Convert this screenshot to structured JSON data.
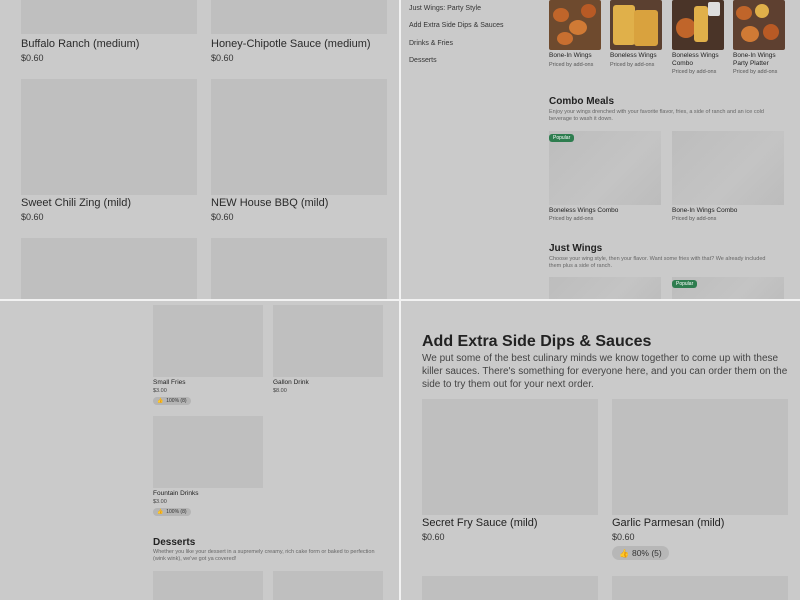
{
  "q1": {
    "items": [
      {
        "name": "Buffalo Ranch (medium)",
        "price": "$0.60"
      },
      {
        "name": "Honey-Chipotle Sauce (medium)",
        "price": "$0.60"
      },
      {
        "name": "Sweet Chili Zing (mild)",
        "price": "$0.60"
      },
      {
        "name": "NEW House BBQ (mild)",
        "price": "$0.60"
      }
    ]
  },
  "q2": {
    "nav": [
      "Just Wings: Party Style",
      "Add Extra Side Dips & Sauces",
      "Drinks & Fries",
      "Desserts"
    ],
    "categories": [
      {
        "name": "Bone-In Wings",
        "sub": "Priced by add-ons"
      },
      {
        "name": "Boneless Wings",
        "sub": "Priced by add-ons"
      },
      {
        "name": "Boneless Wings Combo",
        "sub": "Priced by add-ons"
      },
      {
        "name": "Bone-In Wings Party Platter",
        "sub": "Priced by add-ons"
      }
    ],
    "combo": {
      "title": "Combo Meals",
      "desc": "Enjoy your wings drenched with your favorite flavor, fries, a side of ranch and an ice cold beverage to wash it down.",
      "badge": "Popular",
      "items": [
        {
          "name": "Boneless Wings Combo",
          "sub": "Priced by add-ons"
        },
        {
          "name": "Bone-In Wings Combo",
          "sub": "Priced by add-ons"
        }
      ]
    },
    "just_wings": {
      "title": "Just Wings",
      "desc": "Choose your wing style, then your flavor. Want some fries with that? We already included them plus a side of ranch.",
      "badge": "Popular"
    }
  },
  "q3": {
    "items": [
      {
        "name": "Small Fries",
        "price": "$3.00",
        "rating": "100% (8)"
      },
      {
        "name": "Gallon Drink",
        "price": "$8.00"
      },
      {
        "name": "Fountain Drinks",
        "price": "$3.00",
        "rating": "100% (8)"
      }
    ],
    "desserts": {
      "title": "Desserts",
      "desc": "Whether you like your dessert in a supremely creamy, rich cake form or baked to perfection (wink wink), we've got ya covered!"
    }
  },
  "q4": {
    "title": "Add Extra Side Dips & Sauces",
    "desc": "We put some of the best culinary minds we know together to come up with these killer sauces. There's something for everyone here, and you can order them on the side to try them out for your next order.",
    "items": [
      {
        "name": "Secret Fry Sauce (mild)",
        "price": "$0.60"
      },
      {
        "name": "Garlic Parmesan (mild)",
        "price": "$0.60",
        "rating": "80% (5)"
      }
    ]
  },
  "icons": {
    "rating": "thumbs-up-icon"
  },
  "colors": {
    "badge": "#2e7d4f",
    "placeholder": "#bfbfbf",
    "background": "#cacaca"
  }
}
